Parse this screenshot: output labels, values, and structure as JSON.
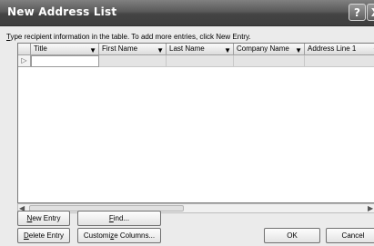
{
  "window": {
    "title": "New Address List",
    "help_label": "?",
    "close_label": "X"
  },
  "instruction": {
    "first_letter": "T",
    "rest": "ype recipient information in the table.  To add more entries, click New Entry."
  },
  "table": {
    "columns": [
      {
        "label": "Title",
        "has_dropdown": true
      },
      {
        "label": "First Name",
        "has_dropdown": true
      },
      {
        "label": "Last Name",
        "has_dropdown": true
      },
      {
        "label": "Company Name",
        "has_dropdown": true
      },
      {
        "label": "Address Line 1",
        "has_dropdown": true
      }
    ],
    "row_marker": "▷",
    "dropdown_glyph": "▼"
  },
  "scrollbar": {
    "left_arrow": "◀",
    "right_arrow": "▶"
  },
  "buttons": {
    "new_entry": {
      "u": "N",
      "rest": "ew Entry"
    },
    "find": {
      "u": "F",
      "rest": "ind..."
    },
    "delete_entry": {
      "u": "D",
      "rest": "elete Entry"
    },
    "customize_columns": {
      "pre": "Customi",
      "u": "z",
      "rest": "e Columns..."
    },
    "ok": "OK",
    "cancel": "Cancel"
  }
}
